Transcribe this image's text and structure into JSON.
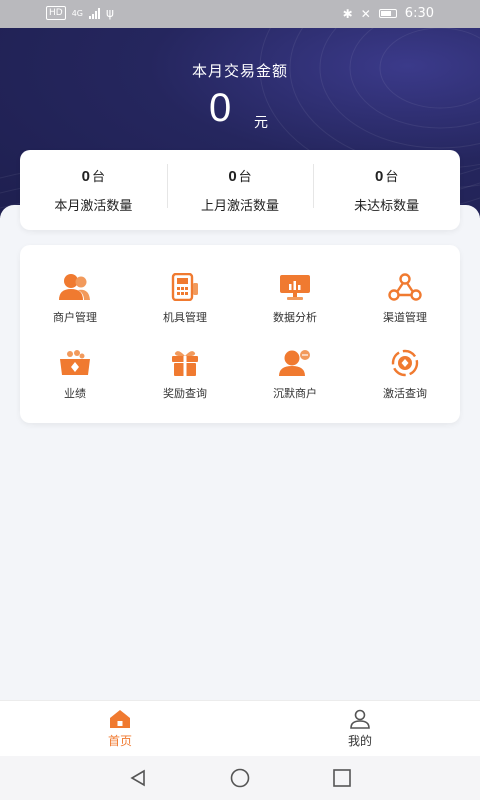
{
  "status_bar": {
    "time": "6:30",
    "network_tag": "HD",
    "network_type": "4G"
  },
  "hero": {
    "title": "本月交易金额",
    "amount": "0",
    "unit": "元"
  },
  "stats": [
    {
      "value": "0",
      "unit": "台",
      "label": "本月激活数量"
    },
    {
      "value": "0",
      "unit": "台",
      "label": "上月激活数量"
    },
    {
      "value": "0",
      "unit": "台",
      "label": "未达标数量"
    }
  ],
  "menu": [
    {
      "label": "商户管理",
      "icon": "merchant-icon"
    },
    {
      "label": "机具管理",
      "icon": "pos-terminal-icon"
    },
    {
      "label": "数据分析",
      "icon": "data-monitor-icon"
    },
    {
      "label": "渠道管理",
      "icon": "channel-network-icon"
    },
    {
      "label": "业绩",
      "icon": "performance-box-icon"
    },
    {
      "label": "奖励查询",
      "icon": "gift-icon"
    },
    {
      "label": "沉默商户",
      "icon": "silent-merchant-icon"
    },
    {
      "label": "激活查询",
      "icon": "activation-icon"
    }
  ],
  "tabs": [
    {
      "label": "首页",
      "icon": "home-icon",
      "active": true
    },
    {
      "label": "我的",
      "icon": "user-icon",
      "active": false
    }
  ],
  "colors": {
    "accent": "#f07a30",
    "hero_bg": "#25265e",
    "text": "#222222"
  }
}
